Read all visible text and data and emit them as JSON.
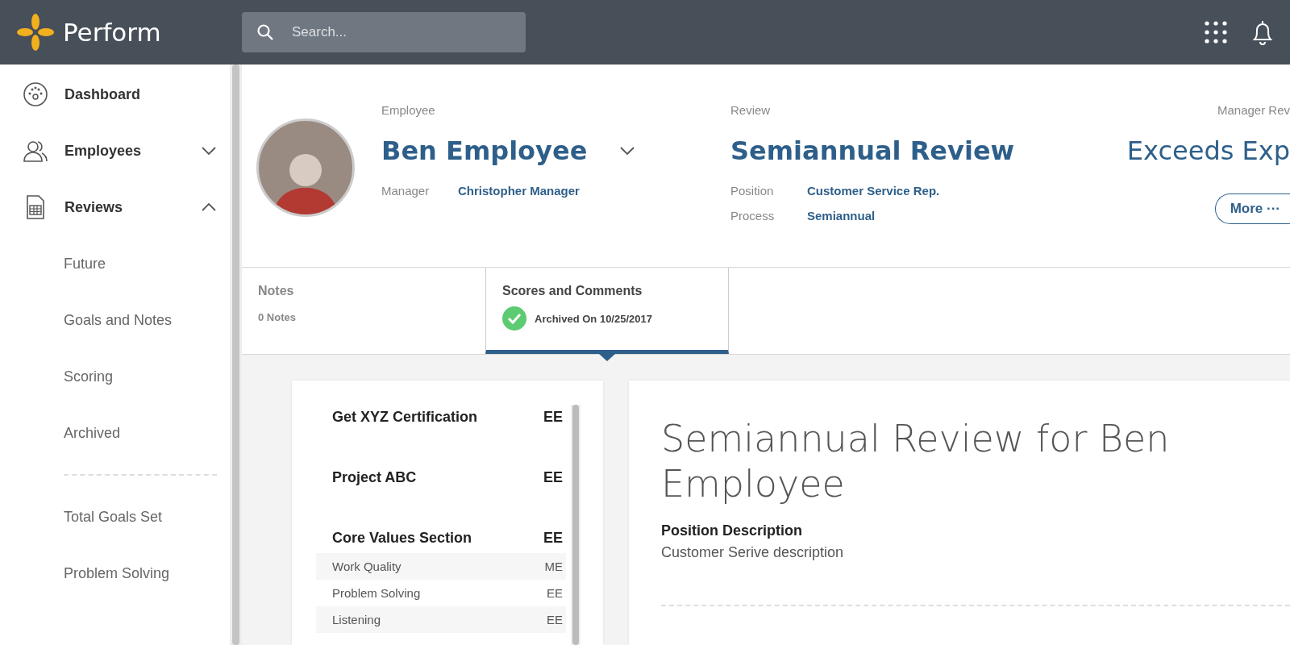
{
  "header": {
    "app_name": "Perform",
    "search": {
      "placeholder": "Search..."
    }
  },
  "sidebar": {
    "items": [
      {
        "label": "Dashboard",
        "kind": "dashboard"
      },
      {
        "label": "Employees",
        "kind": "people",
        "expanded": false
      },
      {
        "label": "Reviews",
        "kind": "reviews",
        "expanded": true,
        "children": [
          {
            "label": "Future"
          },
          {
            "label": "Goals and Notes"
          },
          {
            "label": "Scoring"
          },
          {
            "label": "Archived"
          }
        ]
      }
    ],
    "secondary": [
      {
        "label": "Total Goals Set"
      },
      {
        "label": "Problem Solving"
      }
    ]
  },
  "profile": {
    "employee_label": "Employee",
    "employee_name": "Ben Employee",
    "manager_label": "Manager",
    "manager_name": "Christopher Manager",
    "review_label": "Review",
    "review_name": "Semiannual Review",
    "details": [
      {
        "label": "Position",
        "value": "Customer Service Rep."
      },
      {
        "label": "Process",
        "value": "Semiannual"
      }
    ],
    "rating_label": "Manager Rev",
    "rating": "Exceeds Exp",
    "more_button": "More ···"
  },
  "tabs": [
    {
      "title": "Notes",
      "subtitle": "0 Notes",
      "selected": false,
      "archived": false
    },
    {
      "title": "Scores and Comments",
      "subtitle": "Archived On 10/25/2017",
      "selected": true,
      "archived": true
    }
  ],
  "scores": [
    {
      "label": "Get XYZ Certification",
      "score": "EE",
      "kind": "section"
    },
    {
      "label": "Project ABC",
      "score": "EE",
      "kind": "section"
    },
    {
      "label": "Core Values Section",
      "score": "EE",
      "kind": "section"
    },
    {
      "label": "Work Quality",
      "score": "ME",
      "kind": "item"
    },
    {
      "label": "Problem Solving",
      "score": "EE",
      "kind": "item"
    },
    {
      "label": "Listening",
      "score": "EE",
      "kind": "item"
    }
  ],
  "review": {
    "title": "Semiannual Review for Ben Employee",
    "position_heading": "Position Description",
    "position_text": "Customer Serive description"
  }
}
